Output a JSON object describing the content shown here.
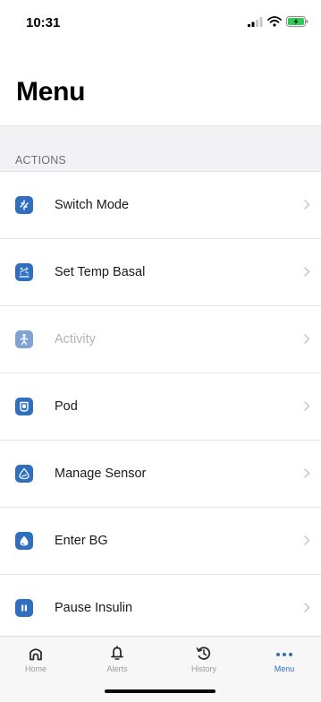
{
  "status_bar": {
    "time": "10:31"
  },
  "page": {
    "title": "Menu"
  },
  "section": {
    "header": "ACTIONS"
  },
  "menu": {
    "items": [
      {
        "label": "Switch Mode",
        "icon": "switch-arrows-icon",
        "enabled": true
      },
      {
        "label": "Set Temp Basal",
        "icon": "temp-basal-icon",
        "enabled": true
      },
      {
        "label": "Activity",
        "icon": "activity-person-icon",
        "enabled": false
      },
      {
        "label": "Pod",
        "icon": "pod-icon",
        "enabled": true
      },
      {
        "label": "Manage Sensor",
        "icon": "sensor-icon",
        "enabled": true
      },
      {
        "label": "Enter BG",
        "icon": "blood-drop-icon",
        "enabled": true
      },
      {
        "label": "Pause Insulin",
        "icon": "pause-icon",
        "enabled": true
      }
    ]
  },
  "tab_bar": {
    "tabs": [
      {
        "label": "Home",
        "icon": "home-icon",
        "active": false
      },
      {
        "label": "Alerts",
        "icon": "bell-icon",
        "active": false
      },
      {
        "label": "History",
        "icon": "history-icon",
        "active": false
      },
      {
        "label": "Menu",
        "icon": "more-dots-icon",
        "active": true
      }
    ]
  },
  "colors": {
    "accent": "#2f6fbe",
    "disabled_icon": "#7ea3d4",
    "disabled_text": "#b3b3b8",
    "section_background": "#f2f2f5",
    "battery_charging": "#34c759"
  }
}
